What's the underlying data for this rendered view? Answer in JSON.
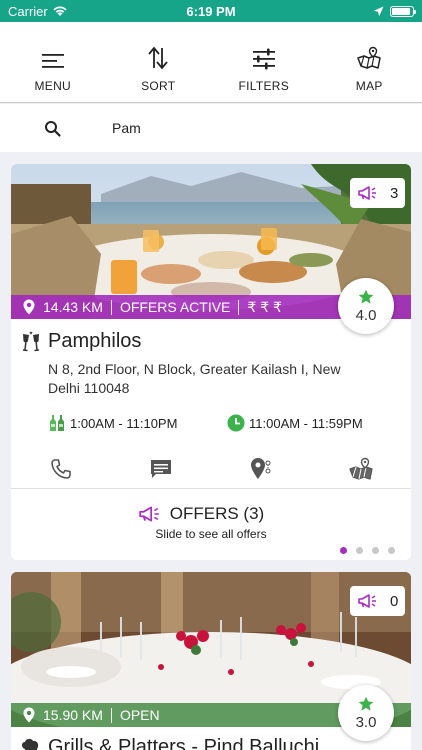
{
  "status": {
    "carrier": "Carrier",
    "time": "6:19 PM"
  },
  "toolbar": [
    {
      "label": "MENU",
      "icon": "menu-icon"
    },
    {
      "label": "SORT",
      "icon": "sort-icon"
    },
    {
      "label": "FILTERS",
      "icon": "filters-icon"
    },
    {
      "label": "MAP",
      "icon": "map-icon"
    }
  ],
  "search": {
    "value": "Pam",
    "placeholder": ""
  },
  "colors": {
    "teal": "#17a589",
    "purple": "#a62fc0",
    "green": "#3bb34a"
  },
  "restaurants": [
    {
      "offer_count": "3",
      "distance": "14.43 KM",
      "status": "OFFERS ACTIVE",
      "price": "₹ ₹ ₹",
      "rating": "4.0",
      "name": "Pamphilos",
      "address": "N 8, 2nd Floor, N Block, Greater Kailash I, New Delhi 110048",
      "bar_hours": "1:00AM - 11:10PM",
      "open_hours": "11:00AM - 11:59PM",
      "actions": [
        "phone-icon",
        "message-icon",
        "directions-icon",
        "map-icon"
      ],
      "offers_title": "OFFERS (3)",
      "offers_subtitle": "Slide to see all offers",
      "page_dots": 4,
      "active_dot": 0
    },
    {
      "offer_count": "0",
      "distance": "15.90 KM",
      "status": "OPEN",
      "rating": "3.0",
      "name": "Grills & Platters - Pind Balluchi"
    }
  ]
}
